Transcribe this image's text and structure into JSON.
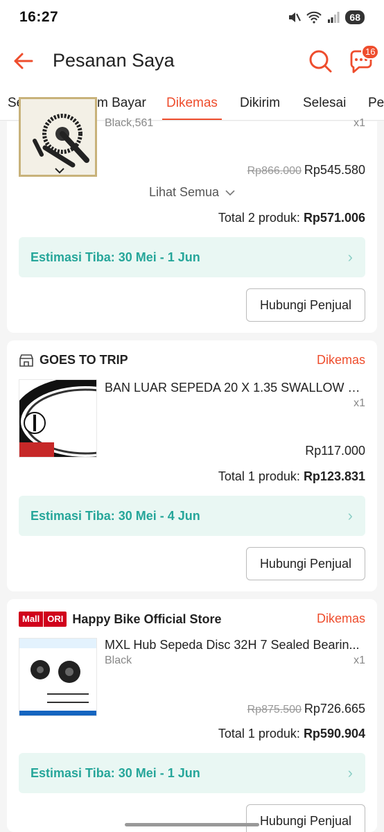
{
  "status_bar": {
    "time": "16:27",
    "battery": "68"
  },
  "header": {
    "title": "Pesanan Saya",
    "chat_badge": "16"
  },
  "tabs": [
    {
      "label": "Semua"
    },
    {
      "label": "Belum Bayar"
    },
    {
      "label": "Dikemas",
      "active": true
    },
    {
      "label": "Dikirim"
    },
    {
      "label": "Selesai"
    },
    {
      "label": "Pe"
    }
  ],
  "orders": [
    {
      "variant": "Black,561",
      "qty": "x1",
      "original_price": "Rp866.000",
      "price": "Rp545.580",
      "see_all": "Lihat Semua",
      "total_label": "Total 2 produk:",
      "total": "Rp571.006",
      "estimate": "Estimasi Tiba: 30 Mei - 1 Jun",
      "contact_button": "Hubungi Penjual"
    },
    {
      "shop": "GOES TO TRIP",
      "status": "Dikemas",
      "product": "BAN LUAR SEPEDA 20 X 1.35 SWALLOW D...",
      "qty": "x1",
      "price": "Rp117.000",
      "total_label": "Total 1 produk:",
      "total": "Rp123.831",
      "estimate": "Estimasi Tiba: 30 Mei - 4 Jun",
      "contact_button": "Hubungi Penjual"
    },
    {
      "mall_label": "Mall",
      "ori_label": "ORI",
      "shop": "Happy Bike Official Store",
      "status": "Dikemas",
      "product": "MXL Hub Sepeda Disc 32H 7 Sealed Bearin...",
      "variant": "Black",
      "qty": "x1",
      "original_price": "Rp875.500",
      "price": "Rp726.665",
      "total_label": "Total 1 produk:",
      "total": "Rp590.904",
      "estimate": "Estimasi Tiba: 30 Mei - 1 Jun",
      "contact_button": "Hubungi Penjual"
    }
  ],
  "colors": {
    "accent": "#ee4d2d",
    "estimate_bg": "#e9f7f3",
    "estimate_text": "#26a69a"
  }
}
